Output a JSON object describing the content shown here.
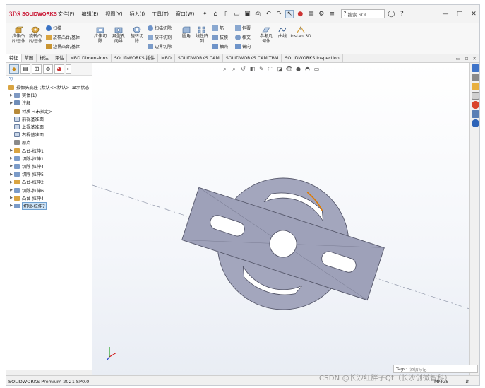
{
  "app": {
    "brand_prefix": "3DS",
    "brand": "SOLIDWORKS",
    "menus": [
      "文件(F)",
      "编辑(E)",
      "视图(V)",
      "插入(I)",
      "工具(T)",
      "窗口(W)"
    ],
    "search_placeholder": "搜索 SOLIDWORKS",
    "search_visible": "搜索 SOL"
  },
  "ribbon": {
    "extrude_boss": "拉伸凸\n台/基体",
    "revolve_boss": "旋转凸\n台/基体",
    "sweep": "扫描",
    "loft": "放样凸台/基体",
    "boundary_boss": "边界凸台/基体",
    "extrude_cut": "拉伸切\n除",
    "hole_wizard": "异型孔\n向导",
    "revolve_cut": "旋转切\n除",
    "swept_cut": "扫描切除",
    "lofted_cut": "放样切割",
    "boundary_cut": "边界切除",
    "fillet": "圆角",
    "linear_pattern": "线性阵\n列",
    "rib": "筋",
    "draft": "拔模",
    "shell": "抽壳",
    "wrap": "包覆",
    "intersect": "相交",
    "mirror": "镜向",
    "ref_geometry": "参考几\n何体",
    "curves": "曲线",
    "instant3d": "Instant3D"
  },
  "tabs": [
    "特征",
    "草图",
    "标注",
    "评估",
    "MBD Dimensions",
    "SOLIDWORKS 插件",
    "MBD",
    "SOLIDWORKS CAM",
    "SOLIDWORKS CAM TBM",
    "SOLIDWORKS Inspection"
  ],
  "tree": {
    "root": "摄像头底座 (默认<<默认>_显示状态",
    "items": [
      {
        "label": "实体(1)",
        "expandable": true,
        "icon": "solid-bodies-icon"
      },
      {
        "label": "注解",
        "expandable": true,
        "icon": "annotations-icon"
      },
      {
        "label": "材质 <未指定>",
        "expandable": false,
        "icon": "material-icon"
      },
      {
        "label": "前视基准面",
        "expandable": false,
        "icon": "plane-icon"
      },
      {
        "label": "上视基准面",
        "expandable": false,
        "icon": "plane-icon"
      },
      {
        "label": "右视基准面",
        "expandable": false,
        "icon": "plane-icon"
      },
      {
        "label": "原点",
        "expandable": false,
        "icon": "origin-icon"
      },
      {
        "label": "凸台-拉伸1",
        "expandable": true,
        "icon": "extrude-icon"
      },
      {
        "label": "切除-拉伸1",
        "expandable": true,
        "icon": "cut-icon"
      },
      {
        "label": "切除-拉伸4",
        "expandable": true,
        "icon": "cut-icon"
      },
      {
        "label": "切除-拉伸5",
        "expandable": true,
        "icon": "cut-icon"
      },
      {
        "label": "凸台-拉伸2",
        "expandable": true,
        "icon": "extrude-icon"
      },
      {
        "label": "切除-拉伸6",
        "expandable": true,
        "icon": "cut-icon"
      },
      {
        "label": "凸台-拉伸4",
        "expandable": true,
        "icon": "extrude-icon"
      },
      {
        "label": "切除-拉伸7",
        "expandable": true,
        "icon": "cut-icon",
        "selected": true
      }
    ]
  },
  "tags": {
    "label": "Tags:",
    "placeholder": "添加标记"
  },
  "status": {
    "version": "SOLIDWORKS Premium 2021 SP0.0",
    "units": "MMGS"
  },
  "watermark": "CSDN @长沙红胖子Qt（长沙创微智科）",
  "colors": {
    "part_gray": "#a3a6bd",
    "part_edge": "#55576a",
    "selected_edge": "#e07a00",
    "brand_red": "#c8102e"
  }
}
